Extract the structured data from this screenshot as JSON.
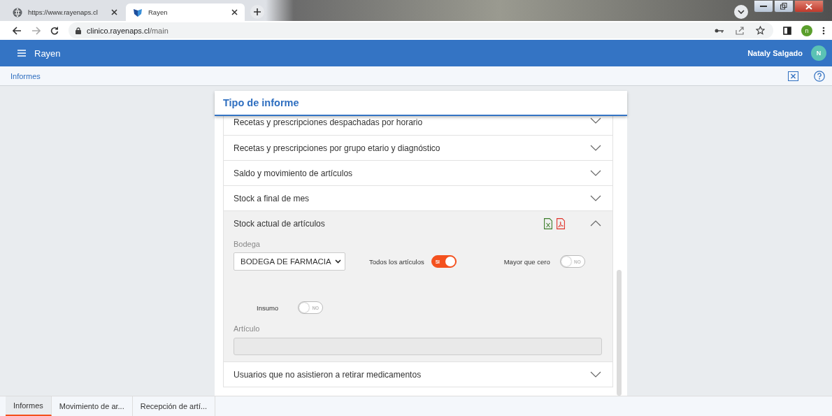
{
  "browser": {
    "tabs": [
      {
        "title": "https://www.rayenaps.cl",
        "selected": false,
        "kind": "site"
      },
      {
        "title": "Rayen",
        "selected": true,
        "kind": "app"
      }
    ],
    "url_host": "clinico.rayenaps.cl",
    "url_path": "/main",
    "profile": "n"
  },
  "app": {
    "title": "Rayen",
    "user": "Nataly Salgado",
    "avatar": "N"
  },
  "breadcrumb": "Informes",
  "card": {
    "title": "Tipo de informe",
    "reports": [
      {
        "label": "Recetas y prescripciones despachadas por horario",
        "expanded": false
      },
      {
        "label": "Recetas y prescripciones por grupo etario y diagnóstico",
        "expanded": false
      },
      {
        "label": "Saldo y movimiento de artículos",
        "expanded": false
      },
      {
        "label": "Stock a final de mes",
        "expanded": false
      },
      {
        "label": "Stock actual de artículos",
        "expanded": true,
        "form": {
          "bodega_label": "Bodega",
          "bodega_value": "BODEGA DE FARMACIA",
          "toggles": [
            {
              "label": "Todos los artículos",
              "on": true,
              "text": "SI"
            },
            {
              "label": "Mayor que cero",
              "on": false,
              "text": "NO"
            },
            {
              "label": "Insumo",
              "on": false,
              "text": "NO"
            }
          ],
          "articulo_label": "Artículo"
        }
      },
      {
        "label": "Usuarios que no asistieron a retirar medicamentos",
        "expanded": false
      }
    ]
  },
  "bottom_tabs": [
    {
      "label": "Informes",
      "selected": true
    },
    {
      "label": "Movimiento de ar...",
      "selected": false
    },
    {
      "label": "Recepción de artí...",
      "selected": false
    }
  ]
}
